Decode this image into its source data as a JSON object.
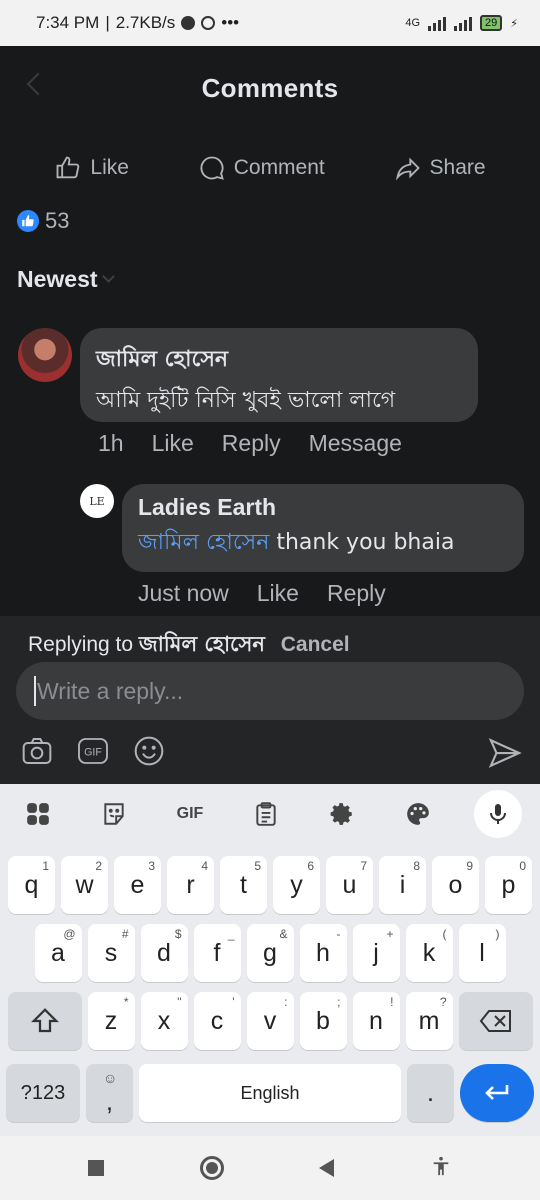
{
  "status_bar": {
    "time": "7:34 PM",
    "net_speed": "2.7KB/s",
    "network": "4G",
    "battery": "29"
  },
  "header": {
    "title": "Comments"
  },
  "actions": {
    "like": "Like",
    "comment": "Comment",
    "share": "Share"
  },
  "reactions": {
    "count": "53"
  },
  "sort": {
    "label": "Newest"
  },
  "comments": [
    {
      "author": "জামিল হোসেন",
      "text": "আমি দুইটি নিসি খুবই ভালো লাগে",
      "time": "1h",
      "like": "Like",
      "reply": "Reply",
      "message": "Message"
    }
  ],
  "reply": {
    "avatar_text": "LE",
    "author": "Ladies Earth",
    "mention": "জামিল হোসেন",
    "text": " thank you bhaia",
    "time": "Just now",
    "like": "Like",
    "reply": "Reply"
  },
  "composer": {
    "replying_prefix": "Replying to ",
    "replying_name": "জামিল হোসেন",
    "cancel": "Cancel",
    "placeholder": "Write a reply..."
  },
  "keyboard": {
    "gif_label": "GIF",
    "row1": [
      [
        "q",
        "1"
      ],
      [
        "w",
        "2"
      ],
      [
        "e",
        "3"
      ],
      [
        "r",
        "4"
      ],
      [
        "t",
        "5"
      ],
      [
        "y",
        "6"
      ],
      [
        "u",
        "7"
      ],
      [
        "i",
        "8"
      ],
      [
        "o",
        "9"
      ],
      [
        "p",
        "0"
      ]
    ],
    "row2": [
      [
        "a",
        "@"
      ],
      [
        "s",
        "#"
      ],
      [
        "d",
        "$"
      ],
      [
        "f",
        "_"
      ],
      [
        "g",
        "&"
      ],
      [
        "h",
        "-"
      ],
      [
        "j",
        "+"
      ],
      [
        "k",
        "("
      ],
      [
        "l",
        ")"
      ]
    ],
    "row3": [
      [
        "z",
        "*"
      ],
      [
        "x",
        "\""
      ],
      [
        "c",
        "'"
      ],
      [
        "v",
        ":"
      ],
      [
        "b",
        ";"
      ],
      [
        "n",
        "!"
      ],
      [
        "m",
        "?"
      ]
    ],
    "sym_label": "?123",
    "comma": ",",
    "space_label": "English",
    "period": "."
  },
  "colors": {
    "accent": "#2d88ff",
    "mention": "#5b9ff5",
    "enter_key": "#1a73e8"
  }
}
